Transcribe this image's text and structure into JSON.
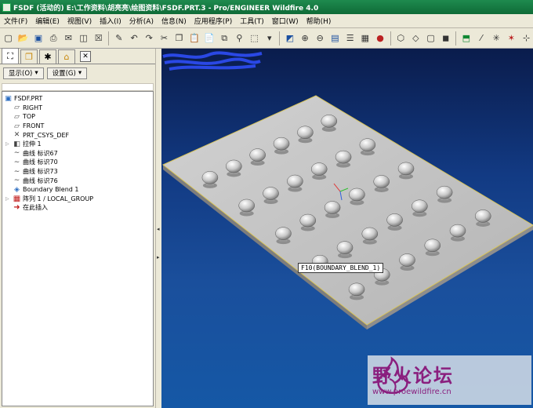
{
  "window": {
    "title": "FSDF (活动的) E:\\工作资料\\胡亮亮\\绘图资料\\FSDF.PRT.3 - Pro/ENGINEER Wildfire 4.0"
  },
  "menu": [
    "文件(F)",
    "编辑(E)",
    "视图(V)",
    "插入(I)",
    "分析(A)",
    "信息(N)",
    "应用程序(P)",
    "工具(T)",
    "窗口(W)",
    "帮助(H)"
  ],
  "panel": {
    "show_button": "显示(O)",
    "settings_button": "设置(G)",
    "close_label": "✕"
  },
  "tree": {
    "root": "FSDF.PRT",
    "items": [
      "RIGHT",
      "TOP",
      "FRONT",
      "PRT_CSYS_DEF",
      "拉伸 1",
      "曲线 标识67",
      "曲线 标识70",
      "曲线 标识73",
      "曲线 标识76",
      "Boundary Blend 1",
      "阵列 1 / LOCAL_GROUP",
      "在此插入"
    ]
  },
  "viewport": {
    "tooltip": "F10(BOUNDARY_BLEND_1)",
    "plate_color": "#c7c7c7",
    "plate_edge": "#d8c45a",
    "button_count": 30
  },
  "watermark": {
    "chinese": "野火论坛",
    "url": "www.proewildfire.cn"
  }
}
